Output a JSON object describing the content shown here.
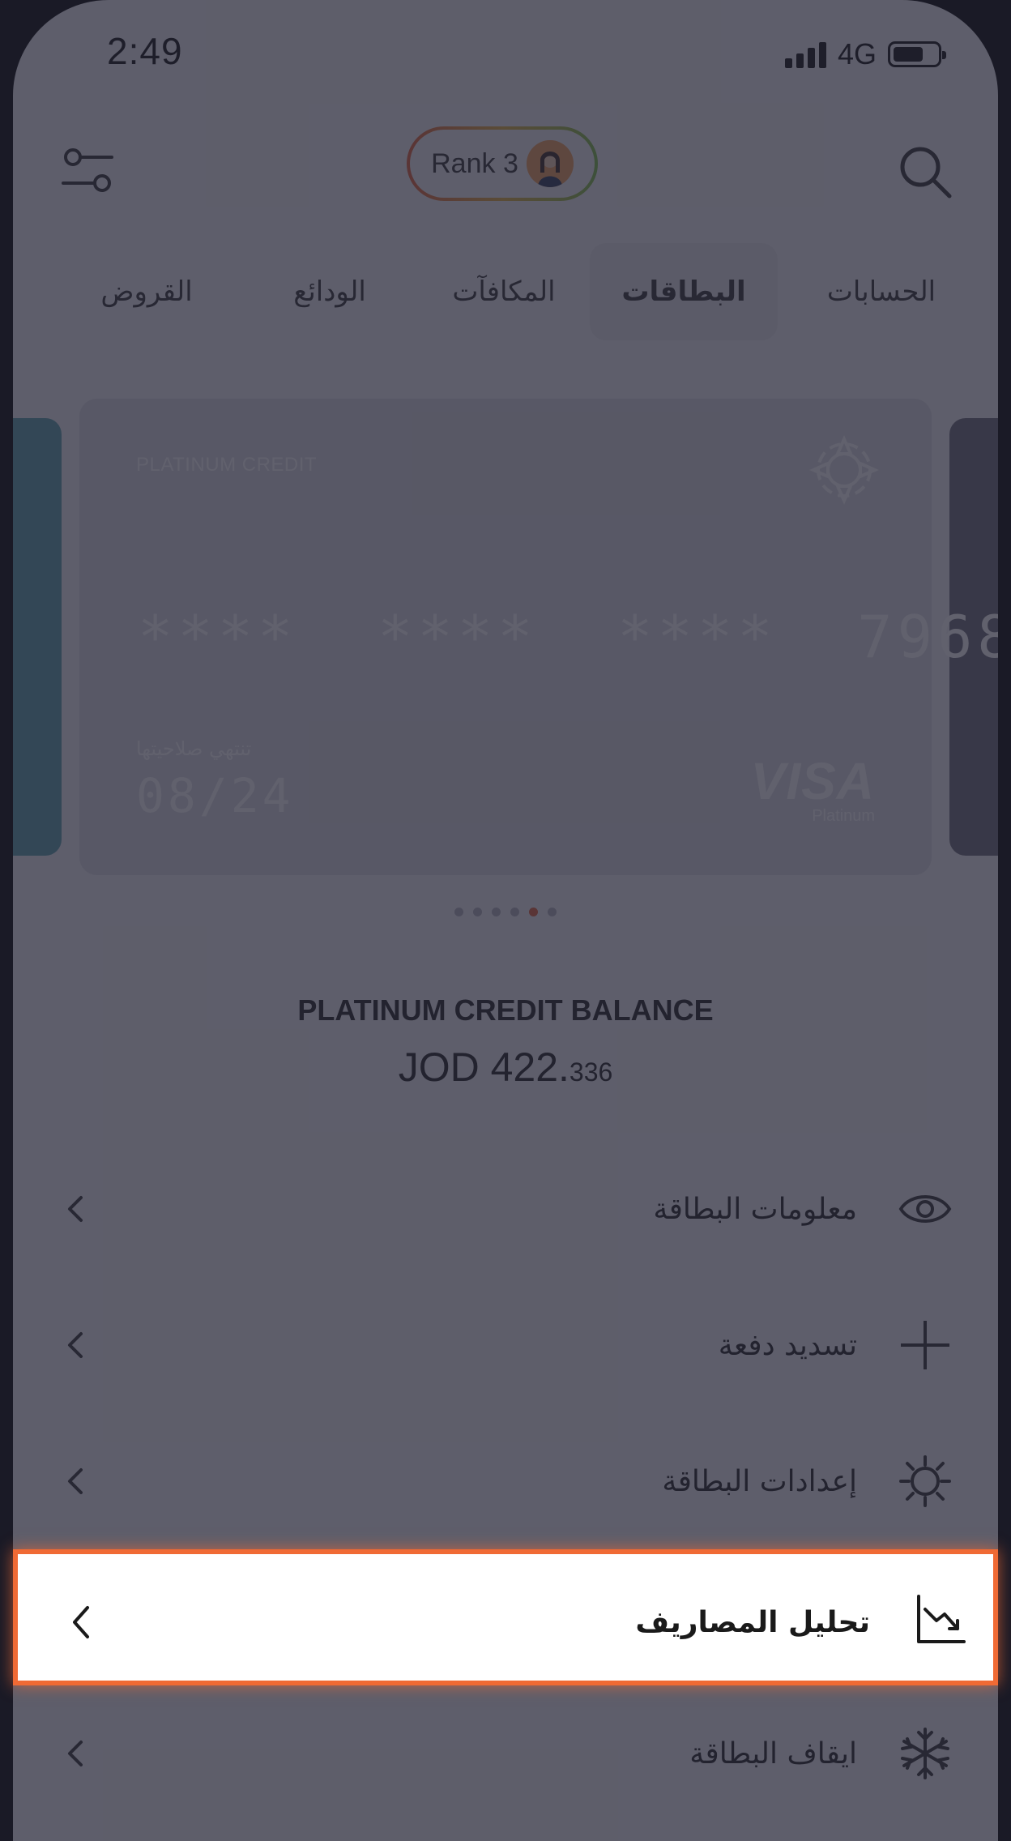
{
  "status_bar": {
    "time": "2:49",
    "network": "4G"
  },
  "header": {
    "rank_label": "Rank 3"
  },
  "tabs": [
    {
      "label": "الحسابات",
      "active": false
    },
    {
      "label": "البطاقات",
      "active": true
    },
    {
      "label": "المكافآت",
      "active": false
    },
    {
      "label": "الودائع",
      "active": false
    },
    {
      "label": "القروض",
      "active": false
    }
  ],
  "card": {
    "type": "PLATINUM CREDIT",
    "number_masked": "****  ****  ****  7968",
    "expiry_label": "تنتهي صلاحيتها",
    "expiry": "08/24",
    "network": "VISA",
    "network_tier": "Platinum"
  },
  "carousel": {
    "count": 6,
    "active_index": 4
  },
  "balance": {
    "title": "PLATINUM CREDIT BALANCE",
    "amount_main": "JOD 422.",
    "amount_decimal": "336"
  },
  "menu": [
    {
      "label": "معلومات البطاقة",
      "icon": "eye-icon"
    },
    {
      "label": "تسديد دفعة",
      "icon": "plus-icon"
    },
    {
      "label": "إعدادات البطاقة",
      "icon": "gear-icon"
    },
    {
      "label": "تحليل المصاريف",
      "icon": "chart-down-icon",
      "highlighted": true
    },
    {
      "label": "ايقاف البطاقة",
      "icon": "snowflake-icon"
    }
  ],
  "colors": {
    "highlight_border": "#f06a34",
    "overlay": "rgba(36,36,52,0.72)"
  }
}
